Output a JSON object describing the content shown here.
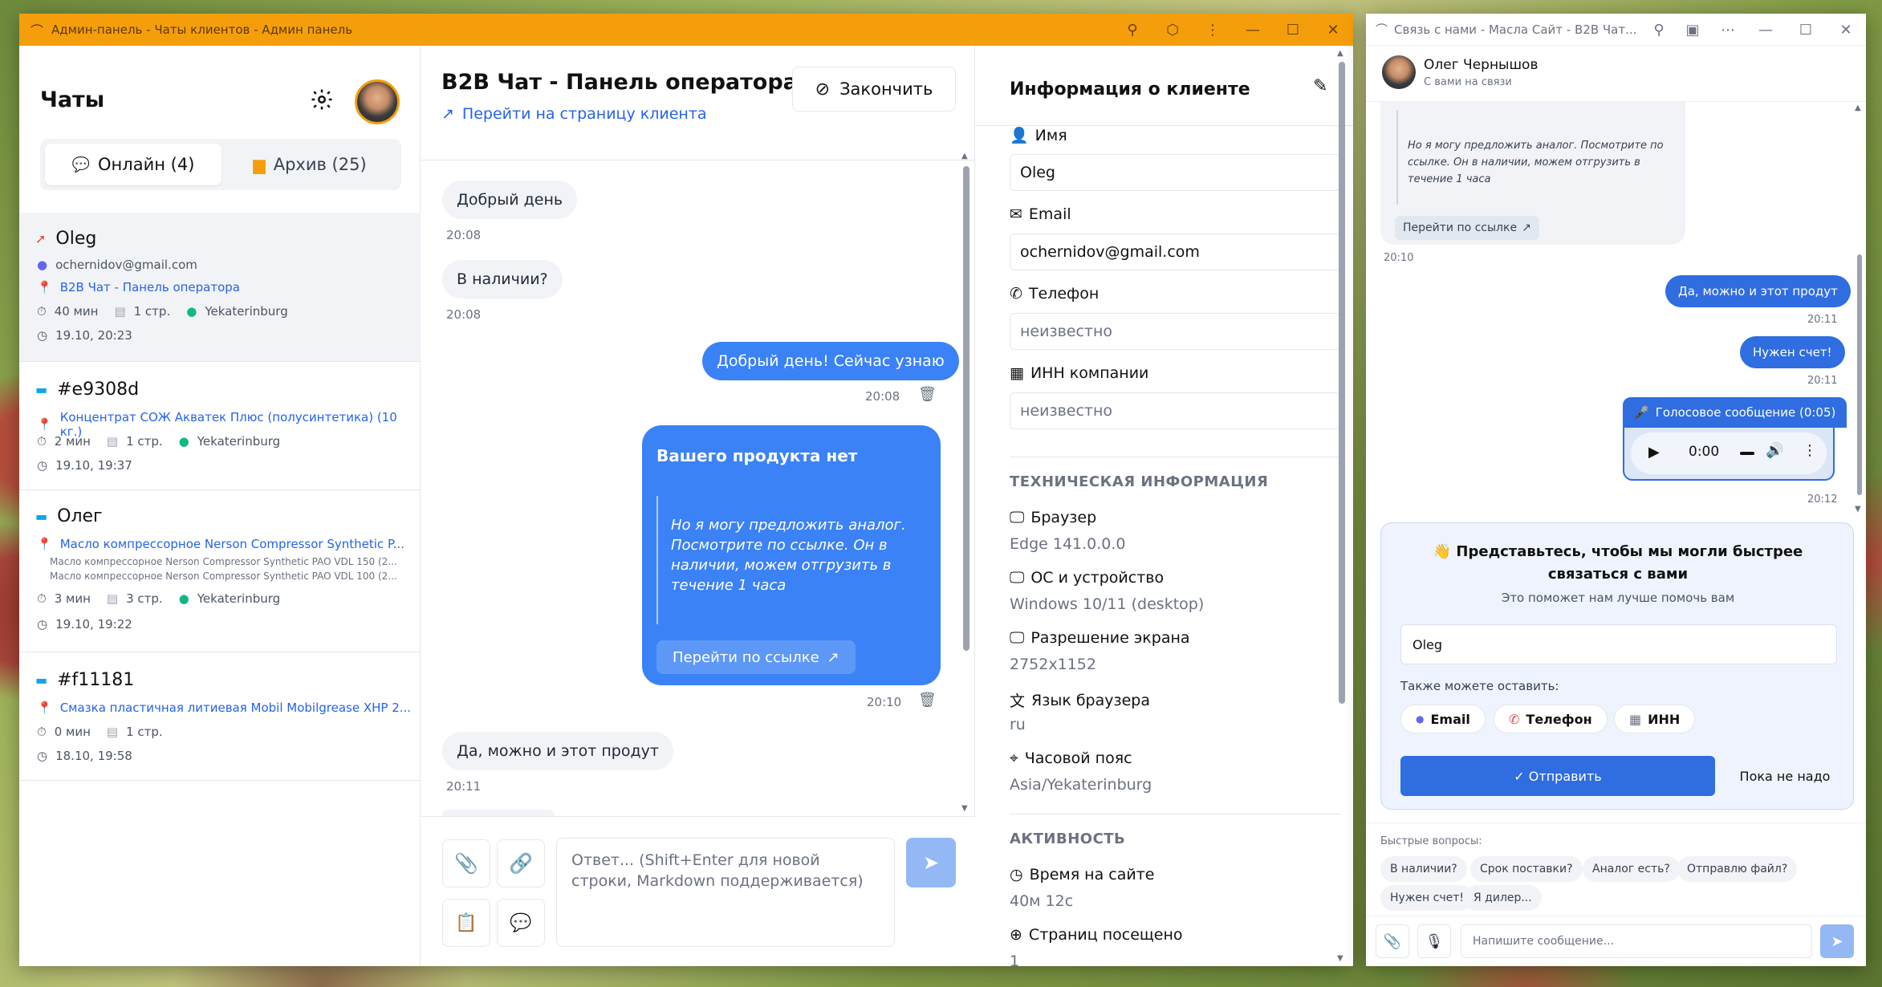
{
  "admin": {
    "title": "Админ-панель - Чаты клиентов - Админ панель",
    "sidebar": {
      "title": "Чаты",
      "tab_online": "Онлайн (4)",
      "tab_archive": "Архив (25)",
      "chats": [
        {
          "name": "Oleg",
          "email": "ochernidov@gmail.com",
          "page": "B2B Чат - Панель оператора",
          "duration": "40 мин",
          "pages": "1 стр.",
          "city": "Yekaterinburg",
          "time": "19.10, 20:23"
        },
        {
          "name": "#e9308d",
          "page": "Концентрат СОЖ Акватек Плюс (полусинтетика) (10 кг.)",
          "duration": "2 мин",
          "pages": "1 стр.",
          "city": "Yekaterinburg",
          "time": "19.10, 19:37"
        },
        {
          "name": "Олег",
          "page": "Масло компрессорное Nerson Compressor Synthetic P...",
          "sub1": "Масло компрессорное Nerson Compressor Synthetic PAO VDL 150 (2...",
          "sub2": "Масло компрессорное Nerson Compressor Synthetic PAO VDL 100 (2...",
          "duration": "3 мин",
          "pages": "3 стр.",
          "city": "Yekaterinburg",
          "time": "19.10, 19:22"
        },
        {
          "name": "#f11181",
          "page": "Смазка пластичная литиевая Mobil Mobilgrease XHP 2...",
          "duration": "0 мин",
          "pages": "1 стр.",
          "time": "18.10, 19:58"
        }
      ]
    },
    "chat": {
      "title": "B2B Чат - Панель оператора",
      "client_link": "Перейти на страницу клиента",
      "finish": "Закончить",
      "m1": "Добрый день",
      "t1": "20:08",
      "m2": "В наличии?",
      "t2": "20:08",
      "m3": "Добрый день! Сейчас узнаю",
      "t3": "20:08",
      "card_title": "Вашего продукта нет",
      "card_quote": "Но я могу предложить аналог. Посмотрите по ссылке. Он в наличии, можем отгрузить в течение 1 часа",
      "card_button": "Перейти по ссылке",
      "t4": "20:10",
      "m5": "Да, можно и этот продут",
      "t5": "20:11",
      "reply_placeholder": "Ответ... (Shift+Enter для новой строки, Markdown поддерживается)"
    },
    "info": {
      "title": "Информация о клиенте",
      "name_label": "Имя",
      "name_value": "Oleg",
      "email_label": "Email",
      "email_value": "ochernidov@gmail.com",
      "phone_label": "Телефон",
      "phone_value": "неизвестно",
      "inn_label": "ИНН компании",
      "inn_value": "неизвестно",
      "tech_title": "ТЕХНИЧЕСКАЯ ИНФОРМАЦИЯ",
      "browser_label": "Браузер",
      "browser_value": "Edge 141.0.0.0",
      "os_label": "ОС и устройство",
      "os_value": "Windows 10/11 (desktop)",
      "res_label": "Разрешение экрана",
      "res_value": "2752x1152",
      "lang_label": "Язык браузера",
      "lang_value": "ru",
      "tz_label": "Часовой пояс",
      "tz_value": "Asia/Yekaterinburg",
      "activity_title": "АКТИВНОСТЬ",
      "time_label": "Время на сайте",
      "time_value": "40м 12с",
      "pages_label": "Страниц посещено",
      "pages_value": "1"
    }
  },
  "widget": {
    "title": "Связь с нами - Масла Сайт - B2B Чат...",
    "operator": "Олег Чернышов",
    "status": "С вами на связи",
    "quote": "Но я могу предложить аналог. Посмотрите по ссылке. Он в наличии, можем отгрузить в течение 1 часа",
    "link": "Перейти по ссылке",
    "t1": "20:10",
    "m1": "Да, можно и этот продут",
    "t2": "20:11",
    "m2": "Нужен счет!",
    "t3": "20:11",
    "voice": "Голосовое сообщение (0:05)",
    "audio_time": "0:00",
    "t4": "20:12",
    "intro_title": "Представьтесь, чтобы мы могли быстрее связаться с вами",
    "intro_sub": "Это поможет нам лучше помочь вам",
    "intro_value": "Oleg",
    "also": "Также можете оставить:",
    "chip_email": "Email",
    "chip_phone": "Телефон",
    "chip_inn": "ИНН",
    "send": "✓ Отправить",
    "later": "Пока не надо",
    "quick_title": "Быстрые вопросы:",
    "quick": [
      "В наличии?",
      "Срок поставки?",
      "Аналог есть?",
      "Отправлю файл?",
      "Нужен счет!",
      "Я дилер..."
    ],
    "input_placeholder": "Напишите сообщение..."
  },
  "colors": {
    "titlebar": "#f59e0b",
    "accent": "#3b82f6",
    "link": "#2563eb",
    "send": "#2f6de1"
  }
}
